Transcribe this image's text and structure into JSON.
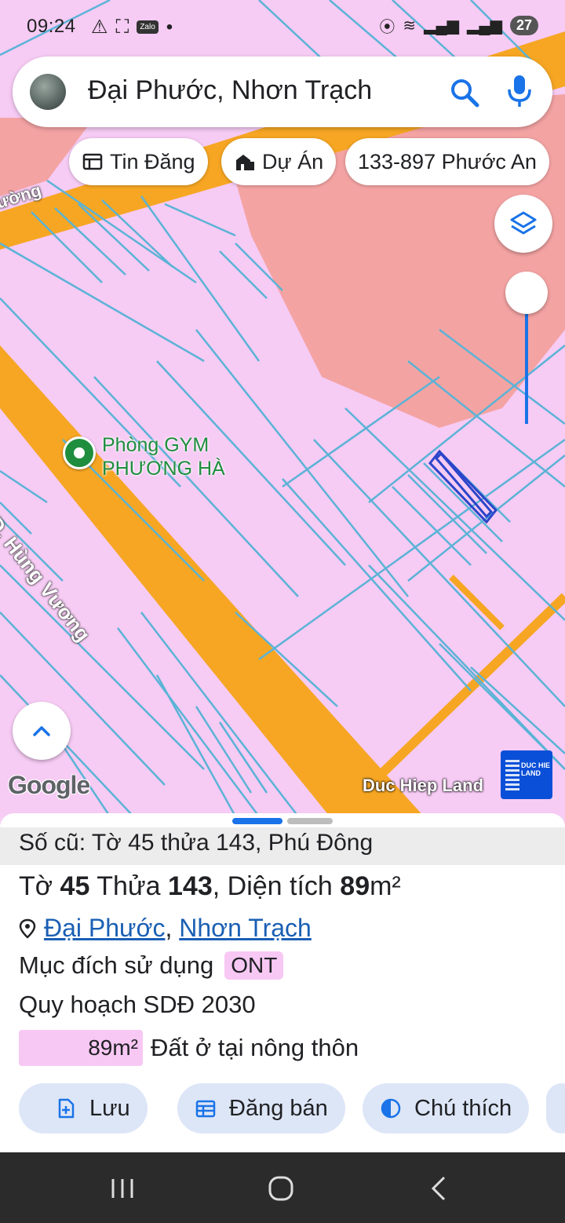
{
  "status_bar": {
    "time": "09:24",
    "notification_icons": [
      "warning-icon",
      "screenshot-icon",
      "zalo-icon"
    ],
    "zalo_label": "Zalo",
    "battery": "27"
  },
  "search": {
    "query": "Đại Phước, Nhơn Trạch"
  },
  "chips": [
    {
      "label": "Tin Đăng",
      "icon": "listing-icon"
    },
    {
      "label": "Dự Án",
      "icon": "building-icon"
    },
    {
      "label": "133-897 Phước An",
      "icon": ""
    }
  ],
  "map": {
    "poi_line1": "Phòng GYM",
    "poi_line2": "PHƯƠNG HÀ",
    "road_main": "Đ. Hùng Vương",
    "road_top": "ường",
    "google": "Google",
    "watermark": "Duc Hiep Land",
    "watermark_logo": "DUC HIE LAND"
  },
  "sheet": {
    "old_info": "Số cũ: Tờ 45 thửa 143, Phú Đông",
    "parcel": {
      "to_label": "Tờ",
      "to_value": "45",
      "thua_label": "Thửa",
      "thua_value": "143",
      "area_label": ", Diện tích",
      "area_value": "89",
      "area_unit": "m²"
    },
    "location_part1": "Đại Phước",
    "location_sep": ",",
    "location_part2": "Nhơn Trạch",
    "usage_label": "Mục đích sử dụng",
    "usage_code": "ONT",
    "plan_label": "Quy hoạch SDĐ 2030",
    "landuse_area": "89m²",
    "landuse_desc": "Đất ở tại nông thôn",
    "actions": [
      {
        "label": "Lưu",
        "icon": "add-doc-icon"
      },
      {
        "label": "Đăng bán",
        "icon": "calendar-icon"
      },
      {
        "label": "Chú thích",
        "icon": "contrast-icon"
      }
    ]
  },
  "colors": {
    "land_residential": "#f6cbf4",
    "land_commercial": "#f4a3a3",
    "road": "#f6a623",
    "parcel_line": "#5bb3d6",
    "accent": "#1a73e8"
  }
}
